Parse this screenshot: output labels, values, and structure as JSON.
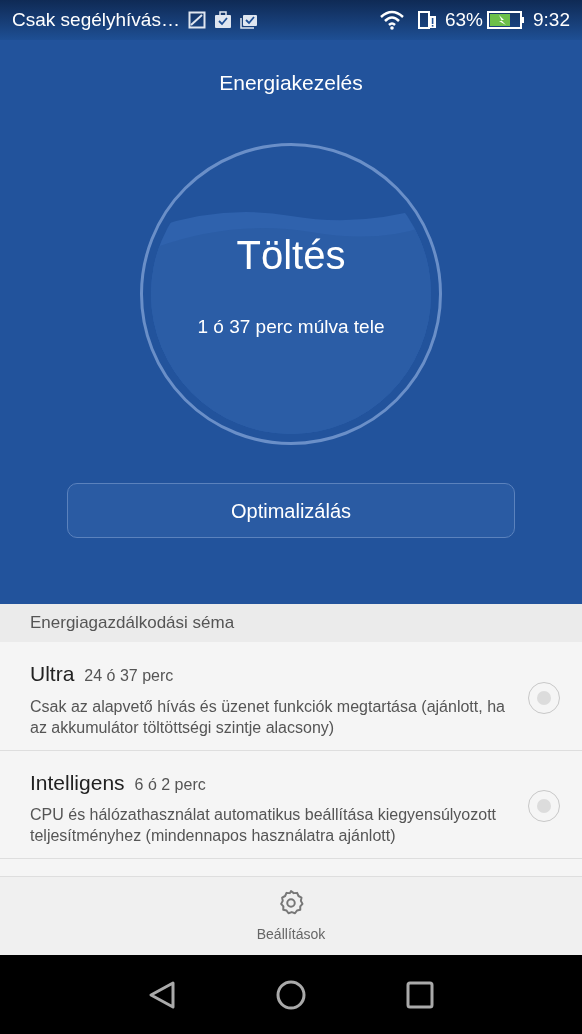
{
  "status_bar": {
    "notification_text": "Csak segélyhívás…",
    "battery_percent": "63%",
    "time": "9:32"
  },
  "title": "Energiakezelés",
  "charge": {
    "state": "Töltés",
    "remaining": "1 ó 37 perc múlva tele"
  },
  "optimize_button": "Optimalizálás",
  "section_header": "Energiagazdálkodási séma",
  "modes": [
    {
      "name": "Ultra",
      "duration": "24 ó 37 perc",
      "description": "Csak az alapvető hívás és üzenet funkciók megtartása (ajánlott, ha az akkumulátor töltöttségi szintje alacsony)",
      "selected": false
    },
    {
      "name": "Intelligens",
      "duration": "6 ó 2 perc",
      "description": "CPU és hálózathasználat automatikus beállítása kiegyensúlyozott teljesítményhez (mindennapos használatra ajánlott)",
      "selected": false
    }
  ],
  "bottom_action": "Beállítások"
}
